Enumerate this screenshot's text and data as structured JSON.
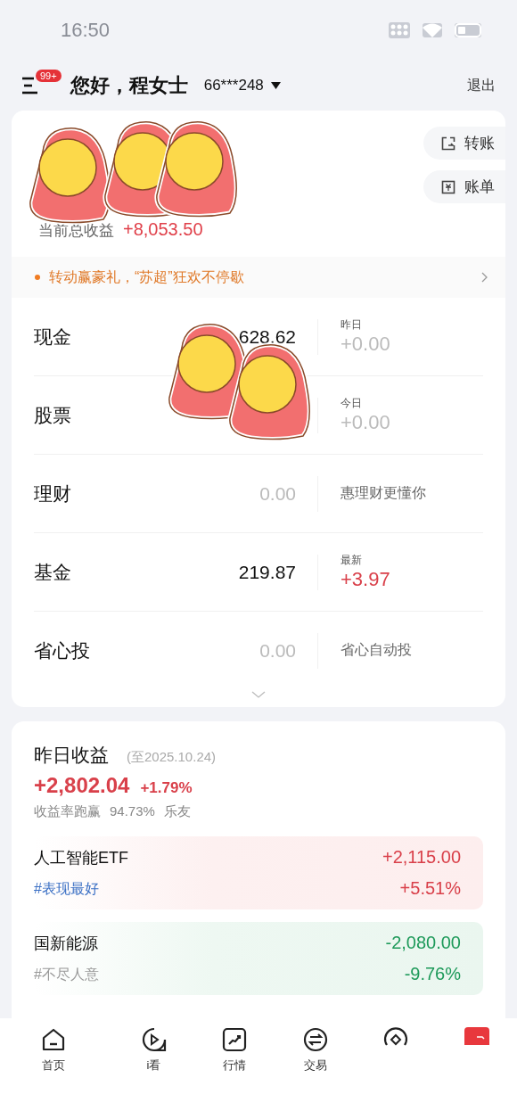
{
  "status_bar": {
    "time": "16:50"
  },
  "header": {
    "menu_badge": "99+",
    "greeting": "您好，程女士",
    "account": "66***248",
    "logout": "退出"
  },
  "assets": {
    "total_profit_label": "当前总收益",
    "total_profit": "+8,053.50",
    "actions": [
      {
        "label": "转账",
        "kind": "transfer"
      },
      {
        "label": "账单",
        "kind": "bill"
      }
    ]
  },
  "stickers": [
    {
      "kind": "sticker"
    },
    {
      "kind": "sticker"
    },
    {
      "kind": "sticker"
    },
    {
      "kind": "sticker"
    },
    {
      "kind": "sticker"
    }
  ],
  "banner": {
    "text": "转动赢豪礼，“苏超”狂欢不停歇"
  },
  "holdings": [
    {
      "name": "现金",
      "value": "628.62",
      "value_muted": false,
      "note_label": "昨日",
      "note": "+0.00",
      "kind": "flat"
    },
    {
      "name": "股票",
      "note_label": "今日",
      "note": "+0.00",
      "kind": "flat"
    },
    {
      "name": "理财",
      "value": "0.00",
      "value_muted": true,
      "note": "惠理财更懂你",
      "kind": "hint"
    },
    {
      "name": "基金",
      "value": "219.87",
      "value_muted": false,
      "note_label": "最新",
      "note": "+3.97",
      "kind": "gain"
    },
    {
      "name": "省心投",
      "value": "0.00",
      "value_muted": true,
      "note": "省心自动投",
      "kind": "hint"
    }
  ],
  "yesterday": {
    "title": "昨日收益",
    "date": "(至2025.10.24)",
    "amount": "+2,802.04",
    "rate": "+1.79%",
    "beat_label": "收益率跑赢",
    "beat_value": "94.73%",
    "beat_suffix": "乐友",
    "funds": [
      {
        "name": "人工智能ETF",
        "tag": "#表现最好",
        "amount": "+2,115.00",
        "rate": "+5.51%",
        "kind": "gain"
      },
      {
        "name": "国新能源",
        "tag": "#不尽人意",
        "amount": "-2,080.00",
        "rate": "-9.76%",
        "kind": "loss"
      }
    ]
  },
  "nav": [
    {
      "label": "首页",
      "kind": "home"
    },
    {
      "label": "i看",
      "kind": "play"
    },
    {
      "label": "行情",
      "kind": "chart"
    },
    {
      "label": "交易",
      "kind": "exchange"
    },
    {
      "kind": "diamond"
    },
    {
      "kind": "square"
    }
  ]
}
